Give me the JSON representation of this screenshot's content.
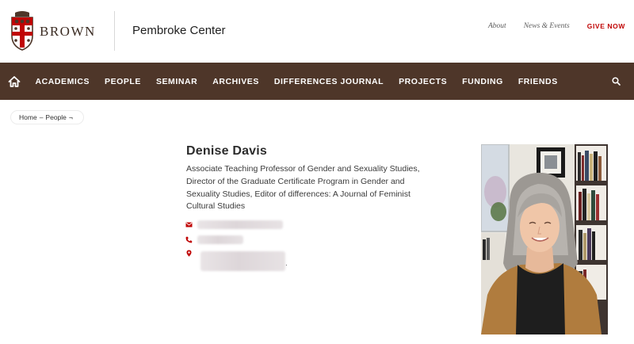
{
  "header": {
    "brand_word": "BROWN",
    "site_title": "Pembroke Center",
    "utility_links": [
      "About",
      "News & Events"
    ],
    "give_label": "GIVE NOW"
  },
  "nav": {
    "home_icon": "home-icon",
    "items": [
      "ACADEMICS",
      "PEOPLE",
      "SEMINAR",
      "ARCHIVES",
      "DIFFERENCES JOURNAL",
      "PROJECTS",
      "FUNDING",
      "FRIENDS"
    ],
    "search_icon": "search-icon"
  },
  "breadcrumb": {
    "home": "Home",
    "separator": "–",
    "current": "People",
    "current_marker": "¬"
  },
  "profile": {
    "name": "Denise Davis",
    "title": "Associate Teaching Professor of Gender and Sexuality Studies, Director of the Graduate Certificate Program in Gender and Sexuality Studies, Editor of differences: A Journal of Feminist Cultural Studies",
    "contact_icons": [
      "envelope-icon",
      "phone-icon",
      "location-pin-icon"
    ],
    "address_trailing": "."
  },
  "colors": {
    "nav_bg": "#4e3629",
    "brand_red": "#c00404",
    "icon_red": "#c00404"
  }
}
